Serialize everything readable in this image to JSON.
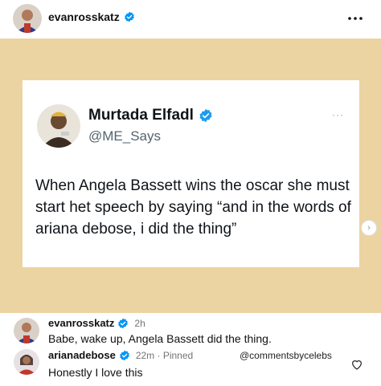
{
  "header": {
    "username": "evanrosskatz",
    "verified_color": "#0095f6"
  },
  "tweet": {
    "name": "Murtada Elfadl",
    "handle": "@ME_Says",
    "more": "···",
    "text": "When Angela Bassett wins the oscar she must start het speech by saying “and in the words of ariana debose, i did the thing”",
    "verified_color": "#1d9bf0"
  },
  "post": {
    "background_color": "#ecd3a2",
    "next_icon": "chevron-right-icon",
    "next_glyph": "›"
  },
  "comments": [
    {
      "username": "evanrosskatz",
      "time": "2h",
      "text": "Babe, wake up, Angela Bassett did the thing."
    },
    {
      "username": "arianadebose",
      "time": "22m · Pinned",
      "text": "Honestly I love this"
    }
  ],
  "watermark": "@commentsbycelebs"
}
